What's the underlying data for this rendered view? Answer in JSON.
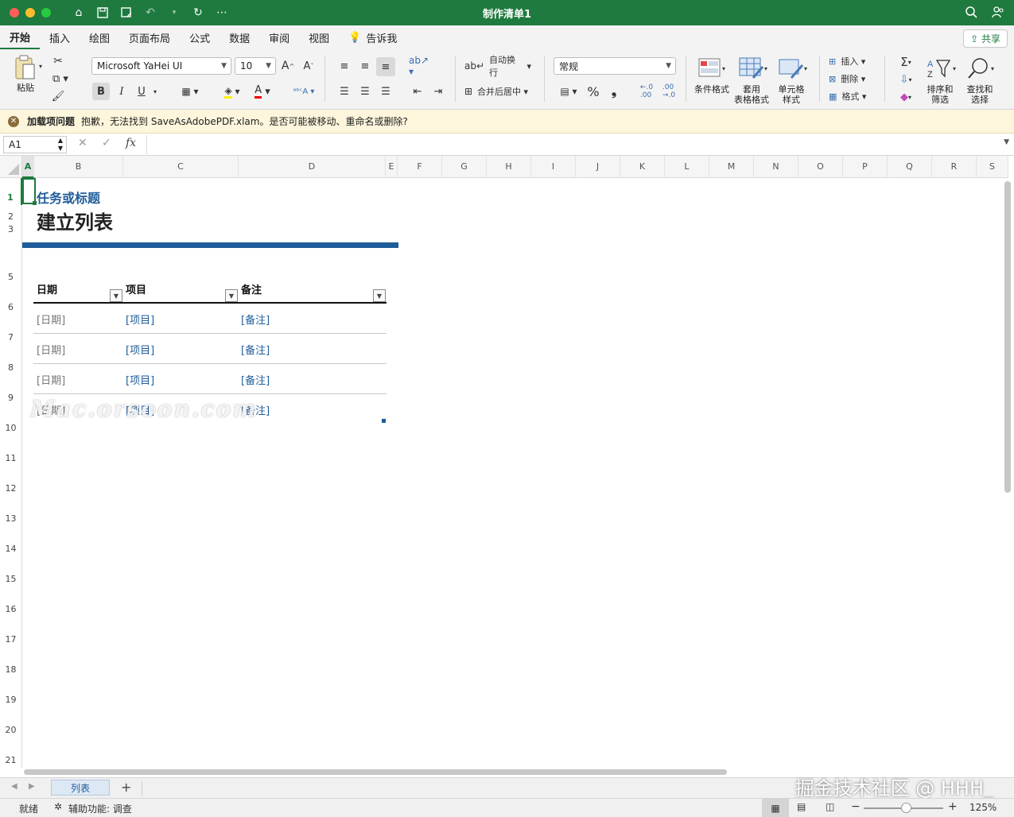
{
  "window": {
    "title": "制作清单1"
  },
  "quick_access": {
    "icons": [
      "home-icon",
      "save-icon",
      "save-as-icon",
      "undo-icon",
      "redo-icon",
      "more-icon"
    ]
  },
  "tabs": [
    "开始",
    "插入",
    "绘图",
    "页面布局",
    "公式",
    "数据",
    "审阅",
    "视图"
  ],
  "tell_me": "告诉我",
  "share_label": "共享",
  "ribbon": {
    "paste": "粘贴",
    "font_name": "Microsoft YaHei UI",
    "font_size": "10",
    "bold": "B",
    "italic": "I",
    "underline": "U",
    "wrap_text": "自动换行",
    "merge_center": "合并后居中",
    "number_format": "常规",
    "conditional_format": "条件格式",
    "table_format": "套用\n表格格式",
    "cell_styles": "单元格\n样式",
    "insert": "插入",
    "delete": "删除",
    "format": "格式",
    "sort_filter": "排序和\n筛选",
    "find_select": "查找和\n选择",
    "percent": "%",
    "comma": "❟"
  },
  "message": {
    "title": "加载项问题",
    "text": "抱歉，无法找到 SaveAsAdobePDF.xlam。是否可能被移动、重命名或删除?"
  },
  "formula_bar": {
    "name_box": "A1",
    "fx": "fx",
    "value": ""
  },
  "columns": [
    "A",
    "B",
    "C",
    "D",
    "E",
    "F",
    "G",
    "H",
    "I",
    "J",
    "K",
    "L",
    "M",
    "N",
    "O",
    "P",
    "Q",
    "R",
    "S"
  ],
  "rows": [
    "1",
    "2",
    "3",
    "5",
    "6",
    "7",
    "8",
    "9",
    "10",
    "11",
    "12",
    "13",
    "14",
    "15",
    "16",
    "17",
    "18",
    "19",
    "20",
    "21"
  ],
  "sheet": {
    "title": "任务或标题",
    "heading": "建立列表",
    "headers": [
      "日期",
      "项目",
      "备注"
    ],
    "rows": [
      [
        "[日期]",
        "[项目]",
        "[备注]"
      ],
      [
        "[日期]",
        "[项目]",
        "[备注]"
      ],
      [
        "[日期]",
        "[项目]",
        "[备注]"
      ],
      [
        "[日期]",
        "[项目]",
        "[备注]"
      ]
    ]
  },
  "watermark": "Mac.orsoon.com",
  "corner_watermark": "掘金技术社区 @ HHH_",
  "sheet_tabs": {
    "active": "列表",
    "add": "+"
  },
  "status": {
    "ready": "就绪",
    "accessibility": "辅助功能: 调查",
    "zoom": "125%"
  }
}
